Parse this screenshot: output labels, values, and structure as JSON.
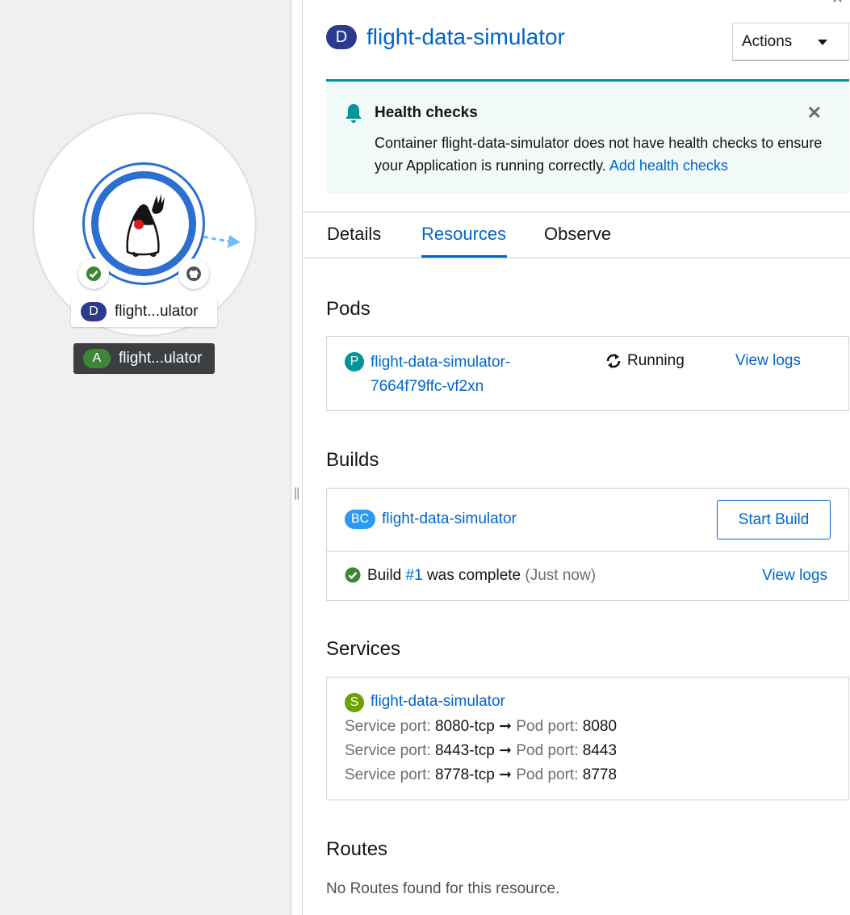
{
  "topology": {
    "node_app_label": "flight...ulator",
    "node_app_badge": "A",
    "node_workload_label": "flight...ulator",
    "node_workload_badge": "D"
  },
  "panel": {
    "close_glyph": "✕",
    "title_badge": "D",
    "title": "flight-data-simulator",
    "actions_label": "Actions",
    "alert": {
      "title": "Health checks",
      "body": "Container flight-data-simulator does not have health checks to ensure your Application is running correctly.",
      "link": "Add health checks",
      "close_glyph": "✕"
    },
    "tabs": [
      {
        "label": "Details"
      },
      {
        "label": "Resources"
      },
      {
        "label": "Observe"
      }
    ],
    "pods": {
      "title": "Pods",
      "badge": "P",
      "name_line1": "flight-data-simulator-",
      "name_line2": "7664f79ffc-vf2xn",
      "status": "Running",
      "logs_link": "View logs"
    },
    "builds": {
      "title": "Builds",
      "badge": "BC",
      "name": "flight-data-simulator",
      "start_button": "Start Build",
      "status_prefix": "Build",
      "build_link": "#1",
      "status_suffix": "was complete",
      "status_time": "(Just now)",
      "logs_link": "View logs"
    },
    "services": {
      "title": "Services",
      "badge": "S",
      "name": "flight-data-simulator",
      "service_port_label": "Service port:",
      "pod_port_label": "Pod port:",
      "ports": [
        {
          "service": "8080-tcp",
          "pod": "8080"
        },
        {
          "service": "8443-tcp",
          "pod": "8443"
        },
        {
          "service": "8778-tcp",
          "pod": "8778"
        }
      ]
    },
    "routes": {
      "title": "Routes",
      "empty": "No Routes found for this resource."
    }
  },
  "colors": {
    "link": "#0066cc",
    "deployment_badge": "#2b3a8c",
    "pod_badge": "#009596",
    "build_badge": "#2b9af3",
    "service_badge": "#6ca100",
    "app_badge": "#3e8635",
    "success": "#3e8635",
    "alert_border": "#009596"
  }
}
